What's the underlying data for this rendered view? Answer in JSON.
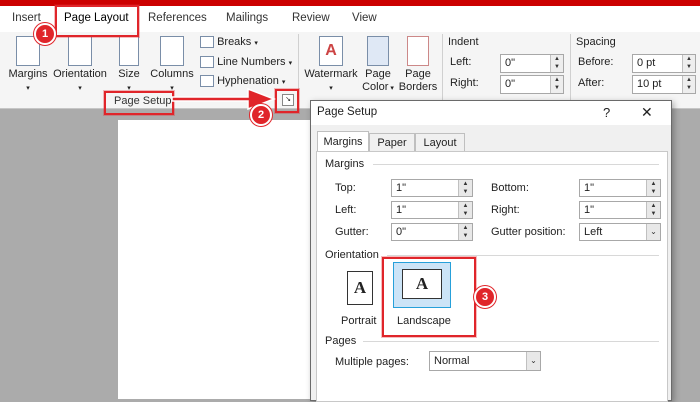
{
  "tabs": [
    "Insert",
    "Page Layout",
    "References",
    "Mailings",
    "Review",
    "View"
  ],
  "ribbon": {
    "margins": "Margins",
    "orientation": "Orientation",
    "size": "Size",
    "columns": "Columns",
    "breaks": "Breaks",
    "line_numbers": "Line Numbers",
    "hyphenation": "Hyphenation",
    "watermark": "Watermark",
    "page_color_1": "Page",
    "page_color_2": "Color",
    "page_borders_1": "Page",
    "page_borders_2": "Borders",
    "page_setup_group": "Page Setup",
    "indent_title": "Indent",
    "indent_left_label": "Left:",
    "indent_left_value": "0\"",
    "indent_right_label": "Right:",
    "indent_right_value": "0\"",
    "spacing_title": "Spacing",
    "spacing_before_label": "Before:",
    "spacing_before_value": "0 pt",
    "spacing_after_label": "After:",
    "spacing_after_value": "10 pt"
  },
  "dialog": {
    "title": "Page Setup",
    "help": "?",
    "close": "✕",
    "tabs": [
      "Margins",
      "Paper",
      "Layout"
    ],
    "margins_group": "Margins",
    "top_label": "Top:",
    "top_value": "1\"",
    "bottom_label": "Bottom:",
    "bottom_value": "1\"",
    "left_label": "Left:",
    "left_value": "1\"",
    "right_label": "Right:",
    "right_value": "1\"",
    "gutter_label": "Gutter:",
    "gutter_value": "0\"",
    "gutter_pos_label": "Gutter position:",
    "gutter_pos_value": "Left",
    "orientation_group": "Orientation",
    "portrait": "Portrait",
    "landscape": "Landscape",
    "pages_group": "Pages",
    "multiple_pages_label": "Multiple pages:",
    "multiple_pages_value": "Normal"
  },
  "badges": [
    "1",
    "2",
    "3"
  ],
  "colors": {
    "accent_red": "#e0252a",
    "title_bar": "#c00000"
  }
}
